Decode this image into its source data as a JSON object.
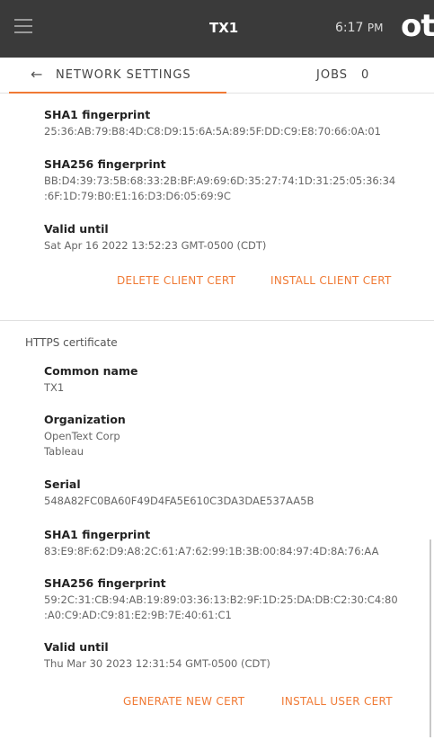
{
  "topbar": {
    "title": "TX1",
    "time": "6:17",
    "ampm": "PM",
    "logo_text": "ot"
  },
  "tabs": {
    "network": "NETWORK SETTINGS",
    "jobs": "JOBS",
    "jobs_count": "0"
  },
  "client_cert": {
    "sha1_label": "SHA1 fingerprint",
    "sha1_value": "25:36:AB:79:B8:4D:C8:D9:15:6A:5A:89:5F:DD:C9:E8:70:66:0A:01",
    "sha256_label": "SHA256 fingerprint",
    "sha256_line1": "BB:D4:39:73:5B:68:33:2B:BF:A9:69:6D:35:27:74:1D:31:25:05:36:34",
    "sha256_line2": ":6F:1D:79:B0:E1:16:D3:D6:05:69:9C",
    "valid_label": "Valid until",
    "valid_value": "Sat Apr 16 2022 13:52:23 GMT-0500 (CDT)",
    "delete_action": "DELETE CLIENT CERT",
    "install_action": "INSTALL CLIENT CERT"
  },
  "https_cert": {
    "heading": "HTTPS certificate",
    "common_name_label": "Common name",
    "common_name_value": "TX1",
    "org_label": "Organization",
    "org_line1": "OpenText Corp",
    "org_line2": "Tableau",
    "serial_label": "Serial",
    "serial_value": "548A82FC0BA60F49D4FA5E610C3DA3DAE537AA5B",
    "sha1_label": "SHA1 fingerprint",
    "sha1_value": "83:E9:8F:62:D9:A8:2C:61:A7:62:99:1B:3B:00:84:97:4D:8A:76:AA",
    "sha256_label": "SHA256 fingerprint",
    "sha256_line1": "59:2C:31:CB:94:AB:19:89:03:36:13:B2:9F:1D:25:DA:DB:C2:30:C4:80",
    "sha256_line2": ":A0:C9:AD:C9:81:E2:9B:7E:40:61:C1",
    "valid_label": "Valid until",
    "valid_value": "Thu Mar 30 2023 12:31:54 GMT-0500 (CDT)",
    "generate_action": "GENERATE NEW CERT",
    "install_action": "INSTALL USER CERT"
  },
  "colors": {
    "accent": "#f07a35",
    "topbar": "#3a3a3a"
  }
}
